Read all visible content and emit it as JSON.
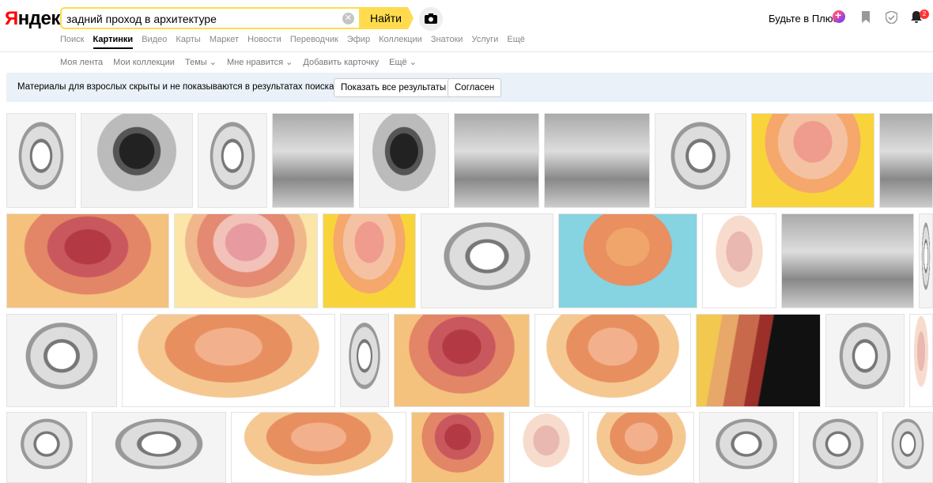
{
  "header": {
    "logo_first": "Я",
    "logo_rest": "ндекс",
    "search_value": "задний проход в архитектуре",
    "search_button": "Найти",
    "plus_text": "Будьте в Плюсе",
    "notifications_count": "2"
  },
  "services": [
    "Поиск",
    "Картинки",
    "Видео",
    "Карты",
    "Маркет",
    "Новости",
    "Переводчик",
    "Эфир",
    "Коллекции",
    "Знатоки",
    "Услуги",
    "Ещё"
  ],
  "active_service": "Картинки",
  "subnav": [
    "Моя лента",
    "Мои коллекции",
    "Темы ⌄",
    "Мне нравится ⌄",
    "Добавить карточку",
    "Ещё ⌄"
  ],
  "notice": {
    "text": "Материалы для взрослых скрыты и не показываются в результатах поиска",
    "show_all": "Показать все результаты",
    "agree": "Согласен"
  },
  "image_rows": [
    [
      "sketch",
      "dark",
      "sketch",
      "gray",
      "dark",
      "gray",
      "gray",
      "sketch",
      "yellow",
      "gray"
    ],
    [
      "red",
      "pink",
      "yellow",
      "sketch",
      "cyan",
      "light",
      "gray",
      "sketch"
    ],
    [
      "sketch",
      "orange",
      "sketch",
      "red",
      "orange",
      "sagittal",
      "sketch",
      "light"
    ],
    [
      "sketch",
      "sketch",
      "orange",
      "red",
      "light",
      "orange",
      "sketch",
      "sketch",
      "sketch"
    ]
  ],
  "colors": {
    "accent_yellow": "#ffdb4d",
    "logo_red": "#ff0000",
    "notice_bg": "#eaf1f8"
  }
}
